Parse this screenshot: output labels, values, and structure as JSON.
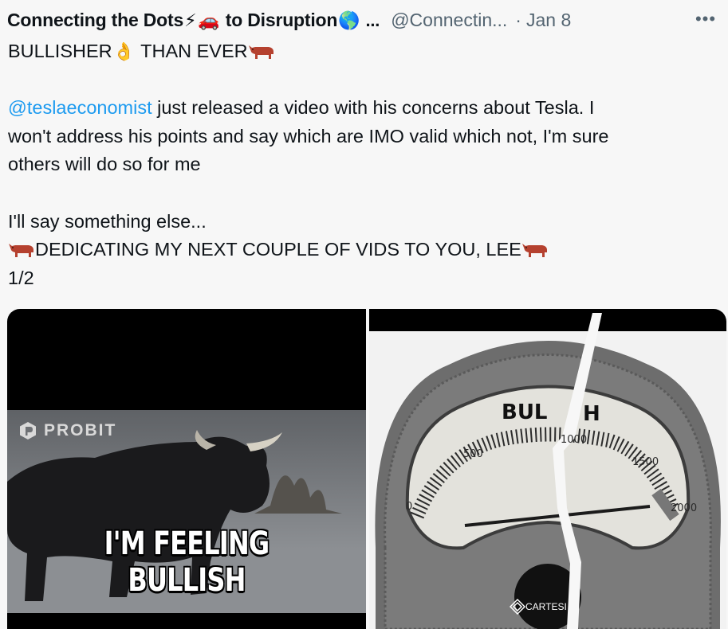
{
  "tweet": {
    "author": {
      "name": "Connecting the Dots",
      "name_mid": "to Disruption",
      "name_ellipsis": "...",
      "emoji_bolt": "⚡",
      "emoji_car": "🚗",
      "emoji_globe": "🌎"
    },
    "handle": "@Connectin...",
    "separator": "·",
    "date": "Jan 8",
    "more_icon": "•••",
    "text": {
      "line1": "BULLISHER",
      "line1_emoji": "👌",
      "line1_rest": "THAN EVER",
      "mention": "@teslaeconomist",
      "line3_rest": " just released a video with his concerns about Tesla. I",
      "line4": "won't address his points and say which are IMO valid which not, I'm sure",
      "line5": "others will do so for me",
      "line7": "I'll say something else...",
      "line8": "DEDICATING MY NEXT COUPLE OF VIDS TO YOU, LEE",
      "line9": "1/2"
    },
    "media": {
      "left": {
        "logo_text": "PROBIT",
        "caption": "I'M FEELING BULLISH"
      },
      "right": {
        "gauge_label_left": "BUL",
        "gauge_label_right": "H",
        "ticks": [
          "0",
          "500",
          "1000",
          "1500",
          "2000"
        ],
        "brand": "CARTESI"
      }
    }
  },
  "colors": {
    "background": "#f7f7f7",
    "text": "#0f1419",
    "secondary": "#536471",
    "link": "#1d9bf0",
    "bull_emoji": "#b5412f"
  }
}
